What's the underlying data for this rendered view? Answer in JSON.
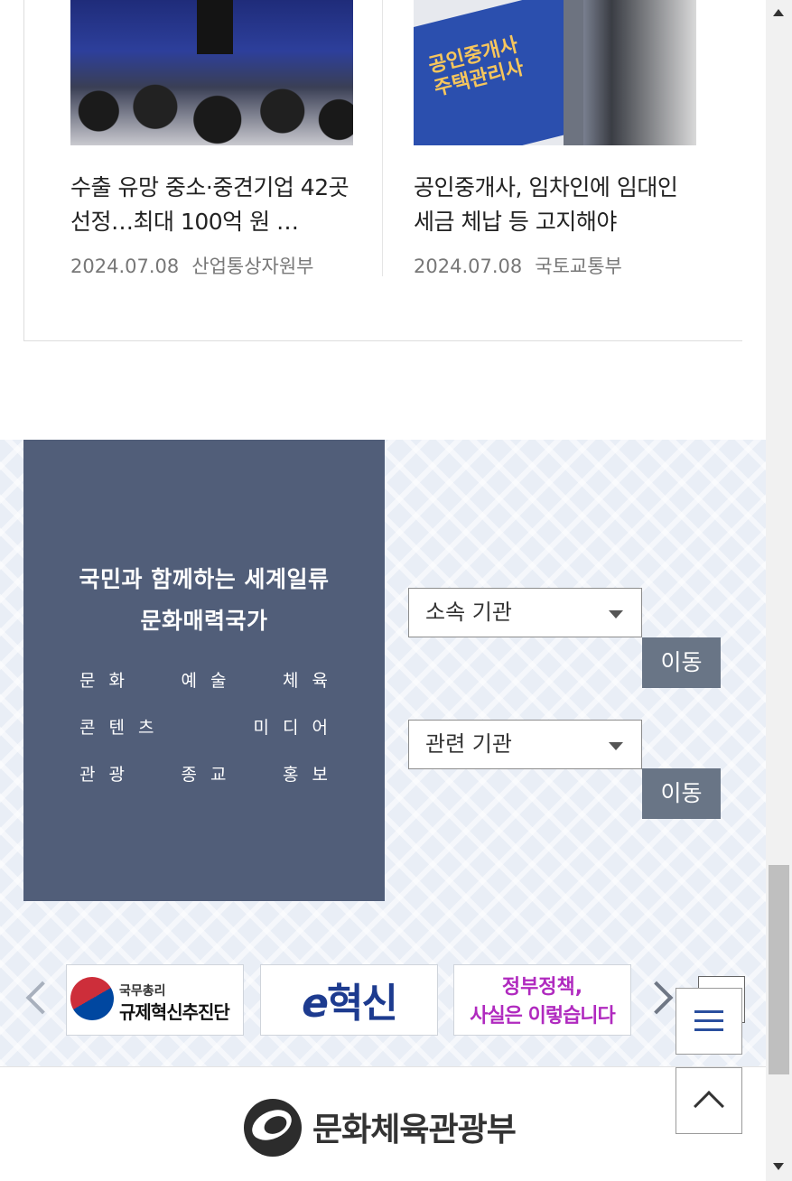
{
  "news": [
    {
      "title": "수출 유망 중소·중견기업 42곳 선정…최대 100억 원 …",
      "date": "2024.07.08",
      "ministry": "산업통상자원부"
    },
    {
      "title": "공인중개사, 임차인에 임대인 세금 체납 등 고지해야",
      "date": "2024.07.08",
      "ministry": "국토교통부",
      "thumb_sign_text": [
        "공인중개사",
        "주택관리사"
      ]
    }
  ],
  "slogan": {
    "title_line1": "국민과 함께하는 세계일류",
    "title_line2": "문화매력국가",
    "fields": [
      [
        "문화",
        "예술",
        "체육"
      ],
      [
        "콘텐츠",
        "미디어"
      ],
      [
        "관광",
        "종교",
        "홍보"
      ]
    ]
  },
  "agency_select": {
    "affiliated_label": "소속 기관",
    "related_label": "관련 기관",
    "go_label": "이동"
  },
  "banners": {
    "regulation_small": "국무총리",
    "regulation_big": "규제혁신추진단",
    "innovation_e": "e",
    "innovation_text": "혁신",
    "fact_line1": "정부정책,",
    "fact_line2": "사실은 이렇습니다"
  },
  "footer": {
    "ministry_name": "문화체육관광부"
  },
  "colors": {
    "panel": "#515e79",
    "go_button": "#697586",
    "section_bg": "#e9eef6",
    "menu_icon": "#2a4f9e"
  },
  "icons": {
    "menu": "hamburger-icon",
    "top": "chevron-up-icon",
    "prev": "chevron-left-icon",
    "next": "chevron-right-icon",
    "more": "plus-icon"
  }
}
